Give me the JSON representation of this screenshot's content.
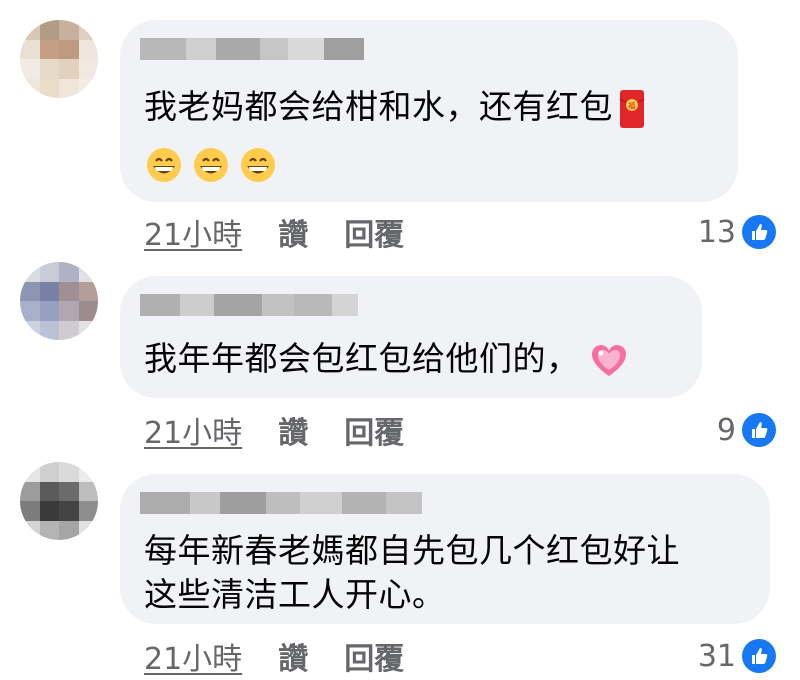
{
  "comments": [
    {
      "text_lines": [
        "我老妈都会给柑和水，还有红包"
      ],
      "emoji_line": [
        "grinning-face",
        "grinning-face",
        "grinning-face"
      ],
      "trailing_icon": "red-envelope-icon",
      "time": "21小時",
      "like_label": "讚",
      "reply_label": "回覆",
      "reactions": "13"
    },
    {
      "text_lines": [
        "我年年都会包红包给他们的，"
      ],
      "trailing_icon": "sparkling-heart-icon",
      "time": "21小時",
      "like_label": "讚",
      "reply_label": "回覆",
      "reactions": "9"
    },
    {
      "text_lines": [
        "每年新春老媽都自先包几个红包好让",
        "这些清洁工人开心。"
      ],
      "time": "21小時",
      "like_label": "讚",
      "reply_label": "回覆",
      "reactions": "31"
    }
  ],
  "colors": {
    "bubble": "#f0f2f5",
    "meta_text": "#65676b",
    "like_blue": "#1877f2"
  }
}
